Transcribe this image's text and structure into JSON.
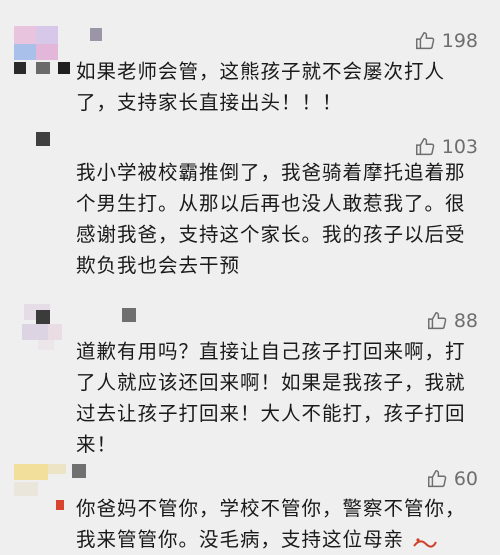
{
  "comments": [
    {
      "likes": "198",
      "lines": [
        "如果老师会管，这熊孩子就不会屡次打人",
        "了，支持家长直接出头！！！"
      ]
    },
    {
      "likes": "103",
      "lines": [
        "我小学被校霸推倒了，我爸骑着摩托追着那",
        "个男生打。从那以后再也没人敢惹我了。很",
        "感谢我爸，支持这个家长。我的孩子以后受",
        "欺负我也会去干预"
      ]
    },
    {
      "likes": "88",
      "lines": [
        "道歉有用吗？直接让自己孩子打回来啊，打",
        "了人就应该还回来啊！如果是我孩子，我就",
        "过去让孩子打回来！大人不能打，孩子打回",
        "来！"
      ]
    },
    {
      "likes": "60",
      "lines": [
        "你爸妈不管你，学校不管你，警察不管你，",
        "我来管管你。没毛病，支持这位母亲"
      ]
    }
  ],
  "icons": {
    "like": "thumbs-up-icon"
  },
  "colors": {
    "background": "#efefef",
    "text": "#1a1a1a",
    "likes": "#6e6e6e"
  }
}
